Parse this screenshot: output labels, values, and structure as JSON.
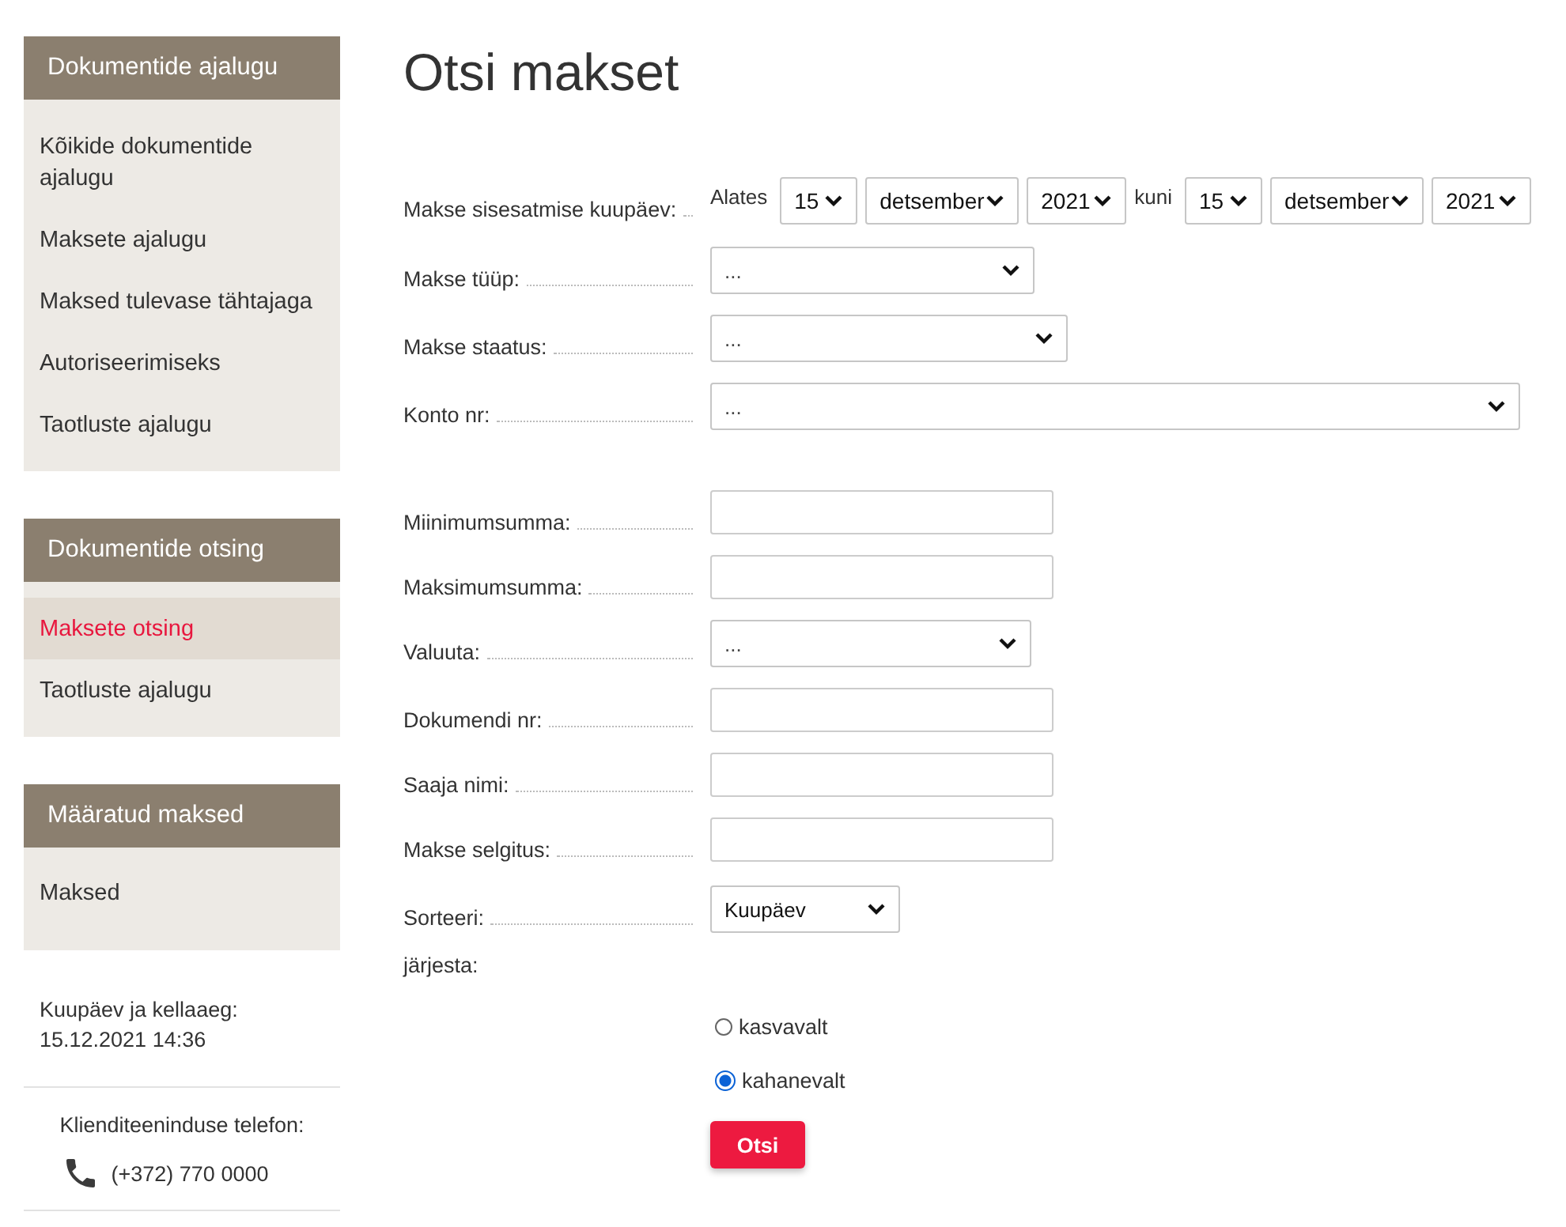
{
  "sidebar": {
    "sections": [
      {
        "title": "Dokumentide ajalugu",
        "items": [
          {
            "label": "Kõikide dokumentide ajalugu",
            "selected": false
          },
          {
            "label": "Maksete ajalugu",
            "selected": false
          },
          {
            "label": "Maksed tulevase tähtajaga",
            "selected": false
          },
          {
            "label": "Autoriseerimiseks",
            "selected": false
          },
          {
            "label": "Taotluste ajalugu",
            "selected": false
          }
        ]
      },
      {
        "title": "Dokumentide otsing",
        "items": [
          {
            "label": "Maksete otsing",
            "selected": true
          },
          {
            "label": "Taotluste ajalugu",
            "selected": false
          }
        ]
      },
      {
        "title": "Määratud maksed",
        "items": [
          {
            "label": "Maksed",
            "selected": false
          }
        ]
      }
    ],
    "datetime": {
      "label": "Kuupäev ja kellaaeg:",
      "value": "15.12.2021 14:36"
    },
    "support": {
      "label": "Klienditeeninduse telefon:",
      "phone": "(+372) 770 0000"
    }
  },
  "page_title": "Otsi makset",
  "form": {
    "rows": [
      {
        "kind": "daterange",
        "label": "Makse sisesatmise kuupäev:",
        "from_label": "Alates",
        "from": [
          "15",
          "detsember",
          "2021"
        ],
        "to_label": "kuni",
        "to": [
          "15",
          "detsember",
          "2021"
        ]
      },
      {
        "kind": "select",
        "label": "Makse tüüp:",
        "value": "..."
      },
      {
        "kind": "select",
        "label": "Makse staatus:",
        "value": "..."
      },
      {
        "kind": "select",
        "label": "Konto nr:",
        "value": "..."
      },
      {
        "kind": "input",
        "label": "Miinimumsumma:"
      },
      {
        "kind": "input",
        "label": "Maksimumsumma:"
      },
      {
        "kind": "select",
        "label": "Valuuta:",
        "value": "..."
      },
      {
        "kind": "input",
        "label": "Dokumendi nr:"
      },
      {
        "kind": "input",
        "label": "Saaja nimi:"
      },
      {
        "kind": "input",
        "label": "Makse selgitus:"
      },
      {
        "kind": "select",
        "label": "Sorteeri:",
        "value": "Kuupäev"
      }
    ],
    "order_label": "järjesta:",
    "order": [
      {
        "label": "kasvavalt",
        "selected": false
      },
      {
        "label": "kahanevalt",
        "selected": true
      }
    ],
    "submit": "Otsi"
  }
}
